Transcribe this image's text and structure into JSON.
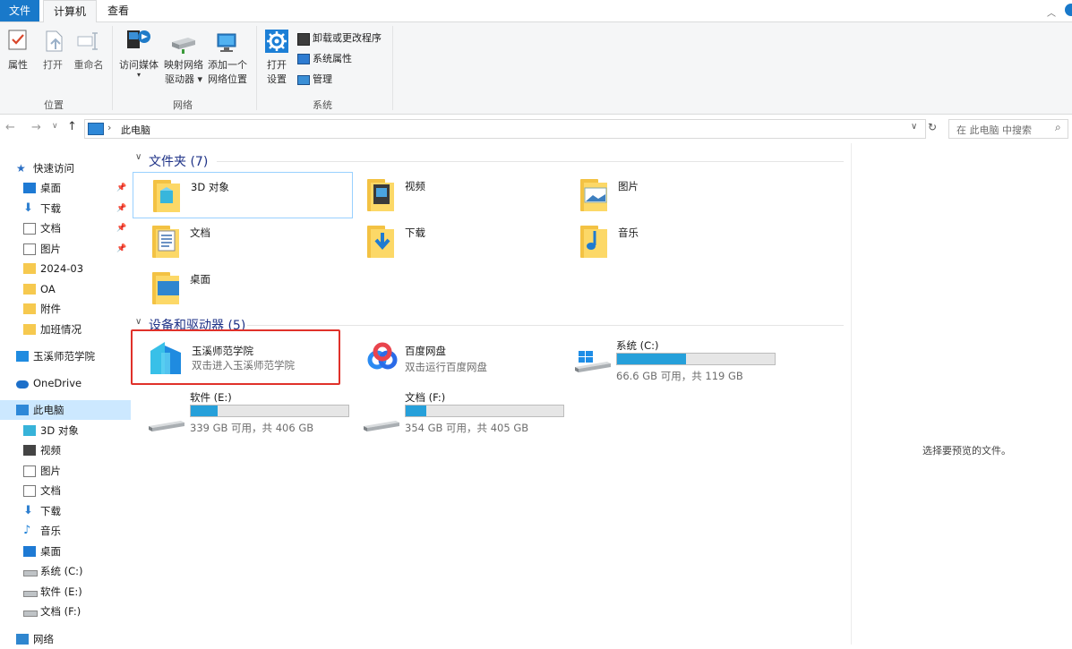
{
  "tabs": {
    "file": "文件",
    "computer": "计算机",
    "view": "查看"
  },
  "ribbon": {
    "properties": "属性",
    "open": "打开",
    "rename": "重命名",
    "group_location": "位置",
    "access_media": "访问媒体",
    "map_drive_1": "映射网络",
    "map_drive_2": "驱动器 ▾",
    "add_loc_1": "添加一个",
    "add_loc_2": "网络位置",
    "group_network": "网络",
    "open_settings_1": "打开",
    "open_settings_2": "设置",
    "uninstall": "卸载或更改程序",
    "sys_props": "系统属性",
    "manage": "管理",
    "group_system": "系统"
  },
  "address": {
    "path": "此电脑",
    "separator": "›",
    "search_placeholder": "在 此电脑 中搜索"
  },
  "sidebar": [
    {
      "label": "快速访问",
      "icon": "star-icon",
      "indent": 0,
      "pin": false
    },
    {
      "label": "桌面",
      "icon": "desktop-icon",
      "indent": 1,
      "pin": true
    },
    {
      "label": "下载",
      "icon": "download-icon",
      "indent": 1,
      "pin": true
    },
    {
      "label": "文档",
      "icon": "document-icon",
      "indent": 1,
      "pin": true
    },
    {
      "label": "图片",
      "icon": "picture-icon",
      "indent": 1,
      "pin": true
    },
    {
      "label": "2024-03",
      "icon": "folder-icon",
      "indent": 1,
      "pin": false
    },
    {
      "label": "OA",
      "icon": "folder-icon",
      "indent": 1,
      "pin": false
    },
    {
      "label": "附件",
      "icon": "folder-icon",
      "indent": 1,
      "pin": false
    },
    {
      "label": "加班情况",
      "icon": "folder-icon",
      "indent": 1,
      "pin": false
    },
    {
      "label": "玉溪师范学院",
      "icon": "app-icon",
      "indent": 0,
      "pin": false
    },
    {
      "label": "OneDrive",
      "icon": "cloud-icon",
      "indent": 0,
      "pin": false
    },
    {
      "label": "此电脑",
      "icon": "computer-icon",
      "indent": 0,
      "pin": false,
      "selected": true
    },
    {
      "label": "3D 对象",
      "icon": "3d-icon",
      "indent": 1,
      "pin": false
    },
    {
      "label": "视频",
      "icon": "video-icon",
      "indent": 1,
      "pin": false
    },
    {
      "label": "图片",
      "icon": "picture-icon",
      "indent": 1,
      "pin": false
    },
    {
      "label": "文档",
      "icon": "document-icon",
      "indent": 1,
      "pin": false
    },
    {
      "label": "下载",
      "icon": "download-icon",
      "indent": 1,
      "pin": false
    },
    {
      "label": "音乐",
      "icon": "music-icon",
      "indent": 1,
      "pin": false
    },
    {
      "label": "桌面",
      "icon": "desktop-icon",
      "indent": 1,
      "pin": false
    },
    {
      "label": "系统 (C:)",
      "icon": "drive-icon",
      "indent": 1,
      "pin": false
    },
    {
      "label": "软件 (E:)",
      "icon": "drive-icon",
      "indent": 1,
      "pin": false
    },
    {
      "label": "文档 (F:)",
      "icon": "drive-icon",
      "indent": 1,
      "pin": false
    },
    {
      "label": "网络",
      "icon": "network-icon",
      "indent": 0,
      "pin": false
    }
  ],
  "folders_header": "文件夹 (7)",
  "folders": [
    {
      "label": "3D 对象",
      "icon": "3d-objects-folder-icon"
    },
    {
      "label": "视频",
      "icon": "videos-folder-icon"
    },
    {
      "label": "图片",
      "icon": "pictures-folder-icon"
    },
    {
      "label": "文档",
      "icon": "documents-folder-icon"
    },
    {
      "label": "下载",
      "icon": "downloads-folder-icon"
    },
    {
      "label": "音乐",
      "icon": "music-folder-icon"
    },
    {
      "label": "桌面",
      "icon": "desktop-folder-icon"
    }
  ],
  "devices_header": "设备和驱动器 (5)",
  "devices": [
    {
      "label": "玉溪师范学院",
      "sub": "双击进入玉溪师范学院",
      "icon": "yxnu-app-icon"
    },
    {
      "label": "百度网盘",
      "sub": "双击运行百度网盘",
      "icon": "baidu-netdisk-icon"
    },
    {
      "label": "系统 (C:)",
      "sub": "66.6 GB 可用，共 119 GB",
      "used_fraction": 0.44,
      "icon": "windows-drive-icon"
    },
    {
      "label": "软件 (E:)",
      "sub": "339 GB 可用，共 406 GB",
      "used_fraction": 0.17,
      "icon": "drive-icon"
    },
    {
      "label": "文档 (F:)",
      "sub": "354 GB 可用，共 405 GB",
      "used_fraction": 0.13,
      "icon": "drive-icon"
    }
  ],
  "preview_text": "选择要预览的文件。",
  "colors": {
    "accent": "#1979ca",
    "bar_fill": "#26a0da",
    "highlight_border": "#e0312a"
  }
}
